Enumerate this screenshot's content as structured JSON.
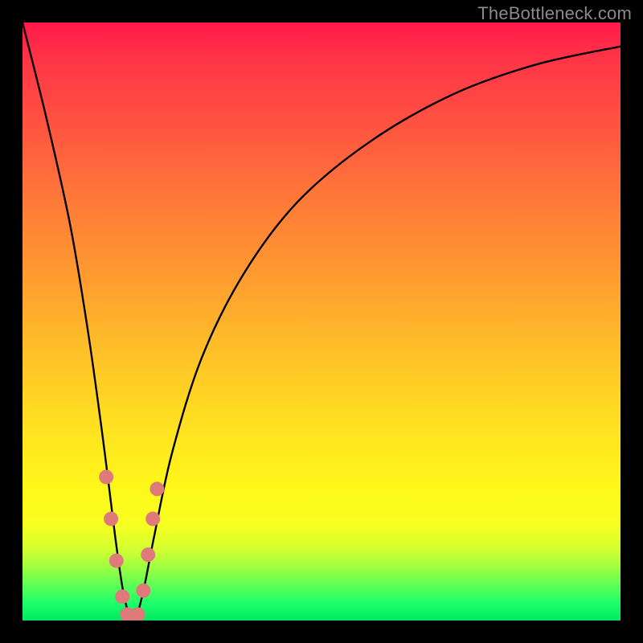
{
  "watermark": "TheBottleneck.com",
  "chart_data": {
    "type": "line",
    "title": "",
    "xlabel": "",
    "ylabel": "",
    "xlim": [
      0,
      100
    ],
    "ylim": [
      0,
      100
    ],
    "series": [
      {
        "name": "bottleneck-curve",
        "x": [
          0,
          4,
          8,
          11,
          13.5,
          15.5,
          17,
          18.5,
          20,
          22,
          25,
          30,
          37,
          46,
          58,
          72,
          86,
          100
        ],
        "values": [
          100,
          84,
          66,
          48,
          30,
          14,
          4,
          0,
          4,
          14,
          28,
          44,
          58,
          70,
          80,
          88,
          93,
          96
        ]
      }
    ],
    "markers": {
      "name": "highlight-dots",
      "color": "#de7a7a",
      "points": [
        {
          "x": 14.0,
          "y": 24
        },
        {
          "x": 14.8,
          "y": 17
        },
        {
          "x": 15.7,
          "y": 10
        },
        {
          "x": 16.7,
          "y": 4
        },
        {
          "x": 17.5,
          "y": 1
        },
        {
          "x": 18.5,
          "y": 0
        },
        {
          "x": 19.3,
          "y": 1
        },
        {
          "x": 20.2,
          "y": 5
        },
        {
          "x": 21.0,
          "y": 11
        },
        {
          "x": 21.8,
          "y": 17
        },
        {
          "x": 22.5,
          "y": 22
        }
      ]
    },
    "background_gradient": {
      "top": "#ff1a4b",
      "mid": "#ffe220",
      "bottom": "#00e860"
    }
  }
}
